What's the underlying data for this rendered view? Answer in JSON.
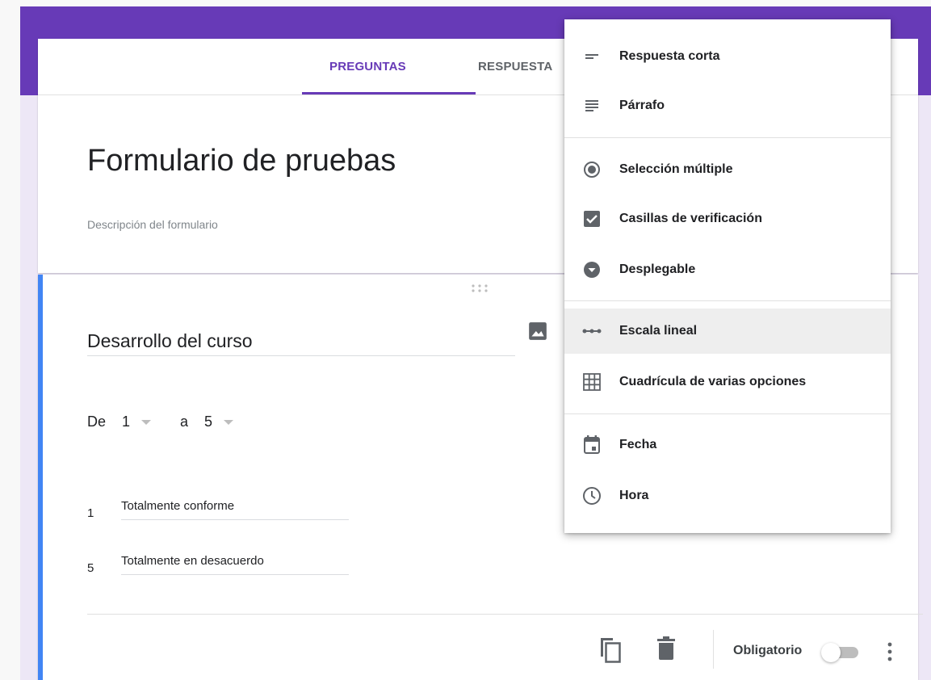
{
  "tabs": [
    {
      "label": "PREGUNTAS",
      "active": true
    },
    {
      "label": "RESPUESTA",
      "active": false
    }
  ],
  "form": {
    "title": "Formulario de pruebas",
    "description_placeholder": "Descripción del formulario"
  },
  "question": {
    "title": "Desarrollo del curso",
    "range": {
      "from_label": "De",
      "from_value": "1",
      "to_label": "a",
      "to_value": "5"
    },
    "labels": [
      {
        "number": "1",
        "text": "Totalmente conforme"
      },
      {
        "number": "5",
        "text": "Totalmente en desacuerdo"
      }
    ],
    "required_label": "Obligatorio",
    "required": false
  },
  "type_menu": {
    "items": [
      {
        "label": "Respuesta corta",
        "icon": "short-text-icon"
      },
      {
        "label": "Párrafo",
        "icon": "paragraph-icon"
      },
      {
        "label": "Selección múltiple",
        "icon": "radio-button-icon"
      },
      {
        "label": "Casillas de verificación",
        "icon": "checkbox-icon"
      },
      {
        "label": "Desplegable",
        "icon": "dropdown-icon"
      },
      {
        "label": "Escala lineal",
        "icon": "linear-scale-icon",
        "highlighted": true
      },
      {
        "label": "Cuadrícula de varias opciones",
        "icon": "grid-icon"
      },
      {
        "label": "Fecha",
        "icon": "calendar-icon"
      },
      {
        "label": "Hora",
        "icon": "clock-icon"
      }
    ]
  },
  "colors": {
    "accent": "#673ab7",
    "question_border": "#4285f4",
    "page_bg": "#ede7f6"
  }
}
